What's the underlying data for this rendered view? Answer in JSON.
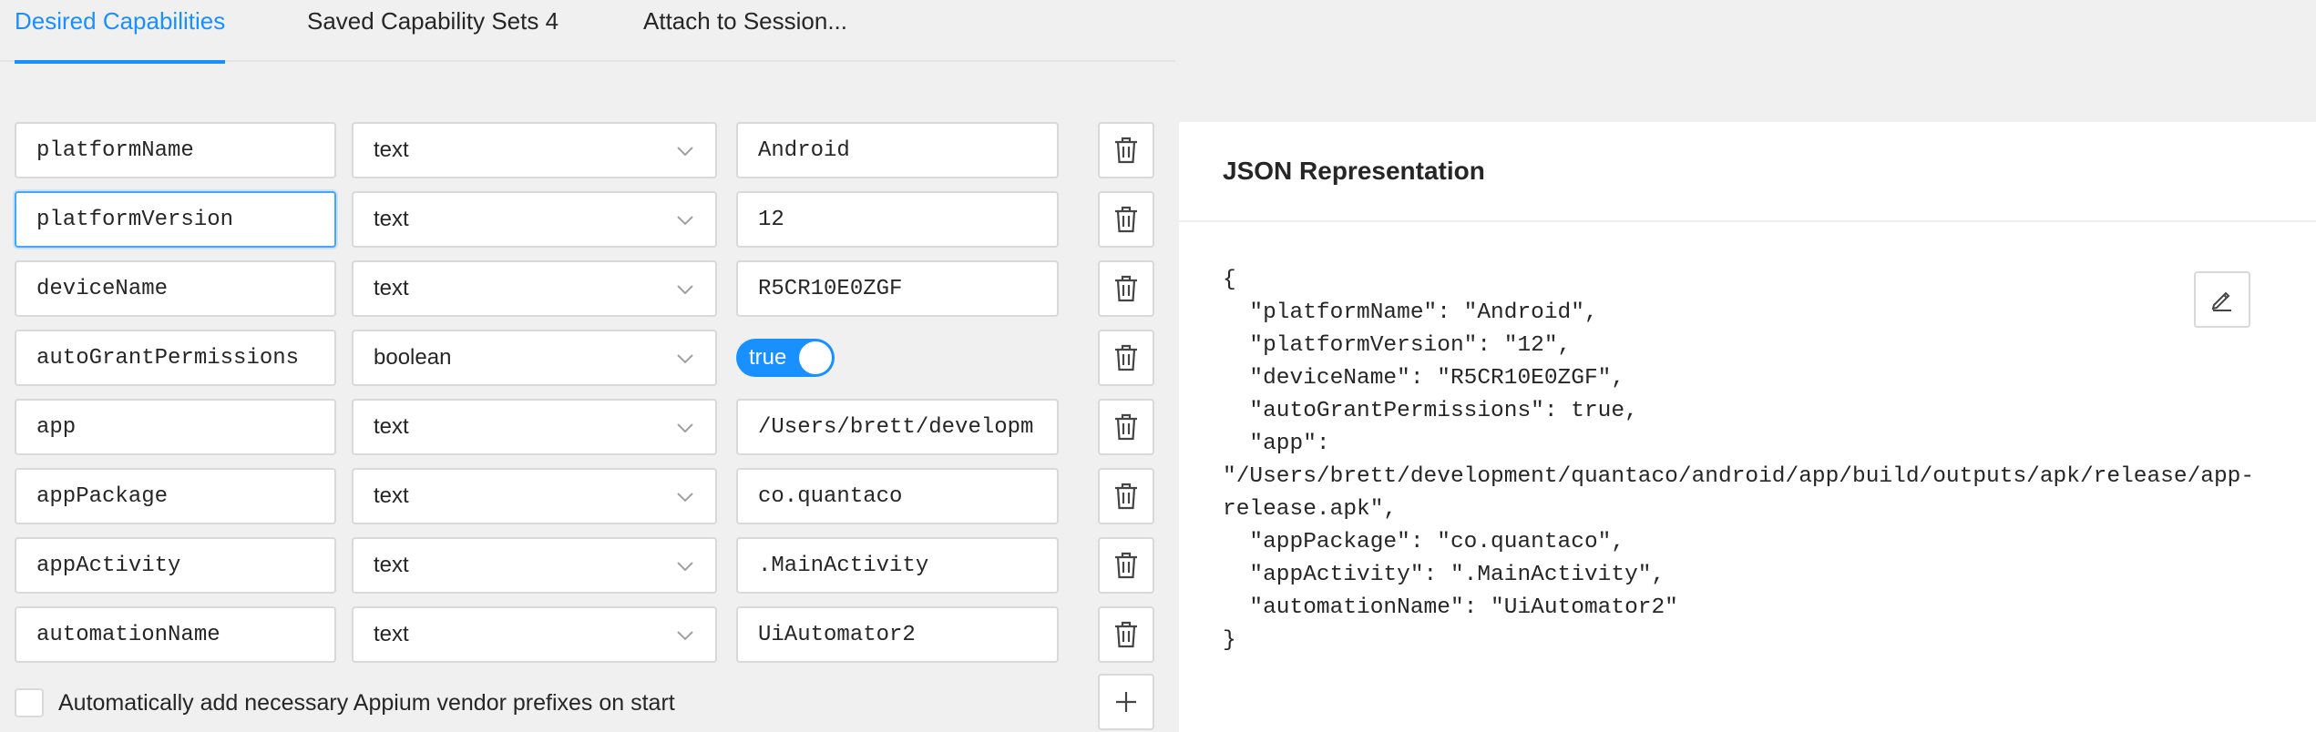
{
  "tabs": [
    {
      "label": "Desired Capabilities",
      "active": true
    },
    {
      "label": "Saved Capability Sets 4",
      "active": false
    },
    {
      "label": "Attach to Session...",
      "active": false
    }
  ],
  "capabilities": [
    {
      "name": "platformName",
      "type": "text",
      "value": "Android"
    },
    {
      "name": "platformVersion",
      "type": "text",
      "value": "12"
    },
    {
      "name": "deviceName",
      "type": "text",
      "value": "R5CR10E0ZGF"
    },
    {
      "name": "autoGrantPermissions",
      "type": "boolean",
      "value": "true"
    },
    {
      "name": "app",
      "type": "text",
      "value": "/Users/brett/developm"
    },
    {
      "name": "appPackage",
      "type": "text",
      "value": "co.quantaco"
    },
    {
      "name": "appActivity",
      "type": "text",
      "value": ".MainActivity"
    },
    {
      "name": "automationName",
      "type": "text",
      "value": "UiAutomator2"
    }
  ],
  "vendor_prefix_label": "Automatically add necessary Appium vendor prefixes on start",
  "json_panel": {
    "title": "JSON Representation",
    "content": "{\n  \"platformName\": \"Android\",\n  \"platformVersion\": \"12\",\n  \"deviceName\": \"R5CR10E0ZGF\",\n  \"autoGrantPermissions\": true,\n  \"app\":\n\"/Users/brett/development/quantaco/android/app/build/outputs/apk/release/app-\nrelease.apk\",\n  \"appPackage\": \"co.quantaco\",\n  \"appActivity\": \".MainActivity\",\n  \"automationName\": \"UiAutomator2\"\n}"
  },
  "colors": {
    "accent": "#1890ff",
    "background": "#f0f0f0",
    "border": "#d9d9d9"
  },
  "icons": {
    "delete": "trash-icon",
    "add": "plus-icon",
    "edit": "pencil-icon",
    "dropdown": "chevron-down-icon"
  }
}
